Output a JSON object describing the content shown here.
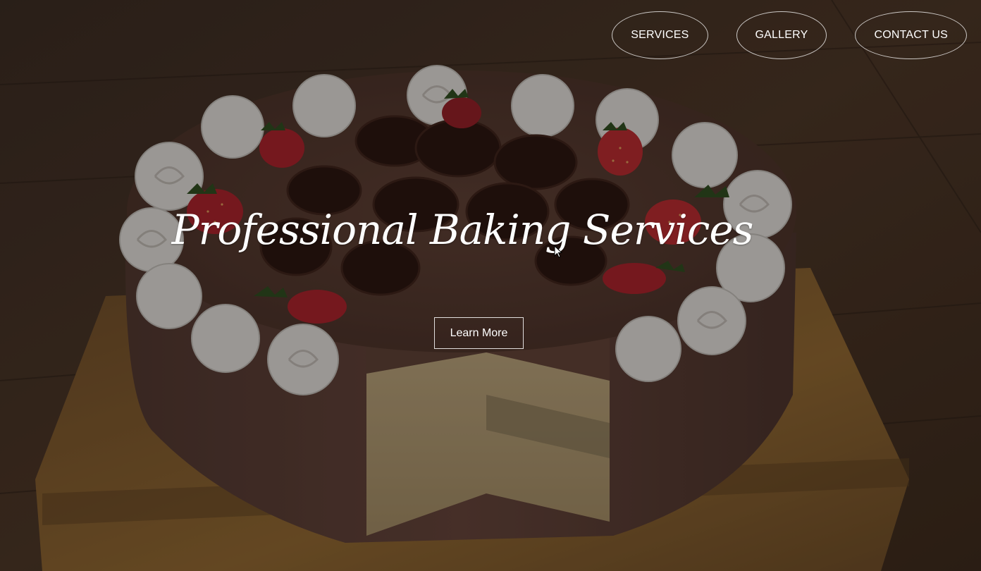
{
  "nav": {
    "items": [
      {
        "label": "SERVICES"
      },
      {
        "label": "GALLERY"
      },
      {
        "label": "CONTACT US"
      }
    ]
  },
  "hero": {
    "title": "Professional Baking Services",
    "cta_label": "Learn More",
    "background": "chocolate-strawberry-cake-photo"
  },
  "colors": {
    "text": "#ffffff",
    "overlay": "rgba(0,0,0,0.28)",
    "wood": "#5a3b24",
    "cake_frosting": "#6f4a3f",
    "cream": "#e8e4df",
    "strawberry": "#b2242a"
  }
}
